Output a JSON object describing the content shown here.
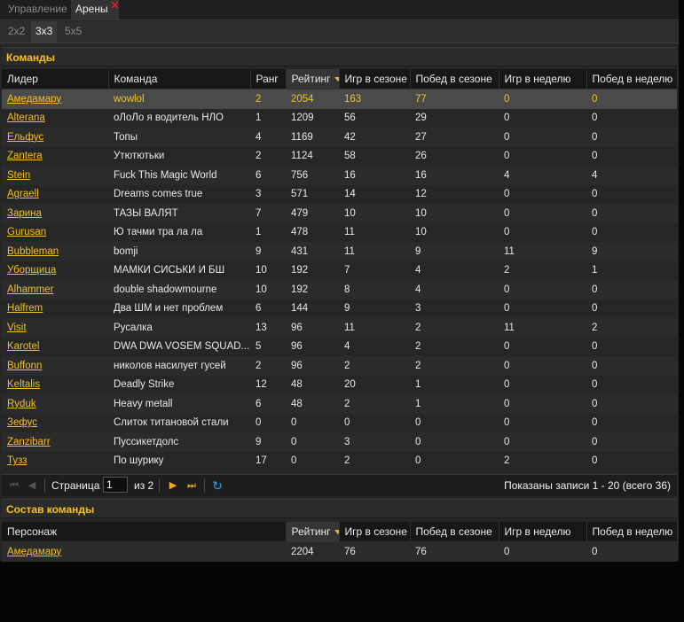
{
  "tabs": [
    {
      "label": "Управление",
      "active": false
    },
    {
      "label": "Арены",
      "active": true
    }
  ],
  "close_glyph": "✕",
  "subtabs": [
    {
      "label": "2x2",
      "active": false
    },
    {
      "label": "3x3",
      "active": true
    },
    {
      "label": "5x5",
      "active": false
    }
  ],
  "teams": {
    "title": "Команды",
    "columns": [
      "Лидер",
      "Команда",
      "Ранг",
      "Рейтинг",
      "Игр в сезоне",
      "Побед в сезоне",
      "Игр в неделю",
      "Побед в неделю"
    ],
    "sorted_column": "Рейтинг",
    "rows": [
      [
        "Амедамару",
        "wowlol",
        "2",
        "2054",
        "163",
        "77",
        "0",
        "0"
      ],
      [
        "Alterana",
        "оЛоЛо я водитель НЛО",
        "1",
        "1209",
        "56",
        "29",
        "0",
        "0"
      ],
      [
        "Ельфус",
        "Топы",
        "4",
        "1169",
        "42",
        "27",
        "0",
        "0"
      ],
      [
        "Zantera",
        "Утютютьки",
        "2",
        "1124",
        "58",
        "26",
        "0",
        "0"
      ],
      [
        "Stein",
        "Fuck This Magic World",
        "6",
        "756",
        "16",
        "16",
        "4",
        "4"
      ],
      [
        "Agraell",
        "Dreams comes true",
        "3",
        "571",
        "14",
        "12",
        "0",
        "0"
      ],
      [
        "Зарина",
        "ТАЗЫ ВАЛЯТ",
        "7",
        "479",
        "10",
        "10",
        "0",
        "0"
      ],
      [
        "Gurusan",
        "Ю тачми тра ла ла",
        "1",
        "478",
        "11",
        "10",
        "0",
        "0"
      ],
      [
        "Bubbleman",
        "bomji",
        "9",
        "431",
        "11",
        "9",
        "11",
        "9"
      ],
      [
        "Уборщица",
        "МАМКИ СИСЬКИ И БШ",
        "10",
        "192",
        "7",
        "4",
        "2",
        "1"
      ],
      [
        "Alhammer",
        "double shadowmourne",
        "10",
        "192",
        "8",
        "4",
        "0",
        "0"
      ],
      [
        "Halfrem",
        "Два ШМ и нет проблем",
        "6",
        "144",
        "9",
        "3",
        "0",
        "0"
      ],
      [
        "Visit",
        "Русалка",
        "13",
        "96",
        "11",
        "2",
        "11",
        "2"
      ],
      [
        "Karotel",
        "DWA DWA VOSEM SQUAD...",
        "5",
        "96",
        "4",
        "2",
        "0",
        "0"
      ],
      [
        "Buffonn",
        "николов насилует гусей",
        "2",
        "96",
        "2",
        "2",
        "0",
        "0"
      ],
      [
        "Keltalis",
        "Deadly Strike",
        "12",
        "48",
        "20",
        "1",
        "0",
        "0"
      ],
      [
        "Ryduk",
        "Heavy metall",
        "6",
        "48",
        "2",
        "1",
        "0",
        "0"
      ],
      [
        "Зефус",
        "Слиток титановой стали",
        "0",
        "0",
        "0",
        "0",
        "0",
        "0"
      ],
      [
        "Zanzibarr",
        "Пуссикетдолс",
        "9",
        "0",
        "3",
        "0",
        "0",
        "0"
      ],
      [
        "Тузз",
        "По шурику",
        "17",
        "0",
        "2",
        "0",
        "2",
        "0"
      ]
    ],
    "selected_row": 0
  },
  "pager": {
    "page_label": "Страница",
    "page_value": "1",
    "of_label": "из 2",
    "info": "Показаны записи 1 - 20 (всего 36)",
    "first_icon": "first-page-icon",
    "prev_icon": "prev-page-icon",
    "next_icon": "next-page-icon",
    "last_icon": "last-page-icon",
    "refresh_icon": "refresh-icon"
  },
  "roster": {
    "title": "Состав команды",
    "columns": [
      "Персонаж",
      "Рейтинг",
      "Игр в сезоне",
      "Побед в сезоне",
      "Игр в неделю",
      "Побед в неделю"
    ],
    "sorted_column": "Рейтинг",
    "rows": [
      [
        "Амедамару",
        "2204",
        "76",
        "76",
        "0",
        "0"
      ]
    ]
  },
  "colors": {
    "accent": "#f5c020",
    "background": "#262626",
    "header": "#171717",
    "selected_row": "#4a4a4a",
    "close": "#e01c1c",
    "refresh": "#2aa3e8"
  }
}
